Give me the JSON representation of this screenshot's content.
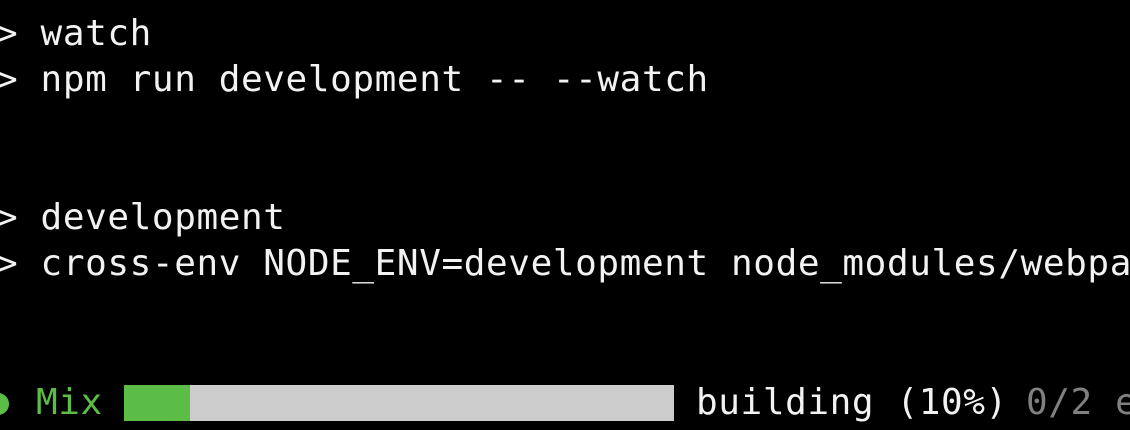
{
  "terminal": {
    "lines": [
      "> watch",
      "> npm run development -- --watch",
      "> development",
      "> cross-env NODE_ENV=development node_modules/webpac"
    ],
    "progress": {
      "label": "Mix",
      "status": "building (10%)",
      "count": "0/2 e",
      "fraction": 0.12
    }
  },
  "colors": {
    "background": "#000000",
    "text": "#f2f2f2",
    "accent_green": "#5bbd45",
    "track": "#cccccc",
    "muted": "#808080"
  },
  "icons": {
    "status": "status-dot-icon"
  }
}
